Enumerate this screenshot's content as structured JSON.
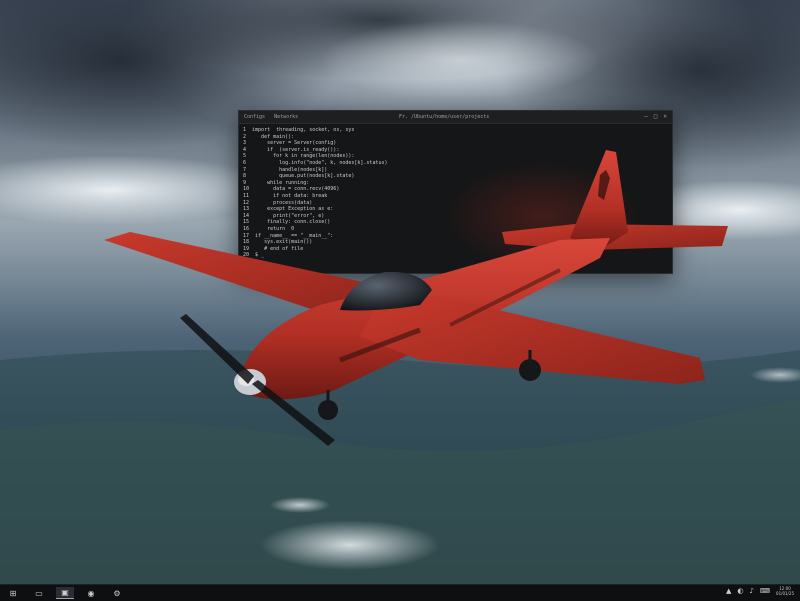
{
  "wallpaper": {
    "description_name": "sky-with-clouds-and-land"
  },
  "terminal": {
    "menu": [
      "Configs",
      "Networks"
    ],
    "title": "Fr. /Ubuntu/home/user/projects",
    "controls": [
      "–",
      "□",
      "×"
    ],
    "lines": [
      "1  import  threading, socket, os, sys",
      "2     def main():",
      "3       server = Server(config)",
      "4       if  (server.is_ready()):",
      "5         for k in range(len(nodes)):",
      "6           log.info(\"node\", k, nodes[k].status)",
      "7           handle(nodes[k])",
      "8           queue.put(nodes[k].state)",
      "9       while running:",
      "10        data = conn.recv(4096)",
      "11        if not data: break",
      "12        process(data)",
      "13      except Exception as e:",
      "14        print(\"error\", e)",
      "15      finally: conn.close()",
      "16      return  0",
      "17  if __name__ == \"__main__\":",
      "18     sys.exit(main())",
      "19     # end of file",
      "20  $ _"
    ]
  },
  "taskbar": {
    "left_items": [
      {
        "name": "start-button",
        "glyph": "⊞"
      },
      {
        "name": "files-button",
        "glyph": "▭"
      },
      {
        "name": "terminal-button",
        "glyph": "▣"
      },
      {
        "name": "browser-button",
        "glyph": "◉"
      },
      {
        "name": "settings-button",
        "glyph": "⚙"
      }
    ],
    "tray": [
      "▲",
      "◐",
      "♪",
      "⌨"
    ],
    "clock_time": "12:00",
    "clock_date": "01/01/25"
  },
  "colors": {
    "plane_red": "#c0392b",
    "sky_dark": "#2c3a48",
    "terminal_bg": "#151617"
  }
}
